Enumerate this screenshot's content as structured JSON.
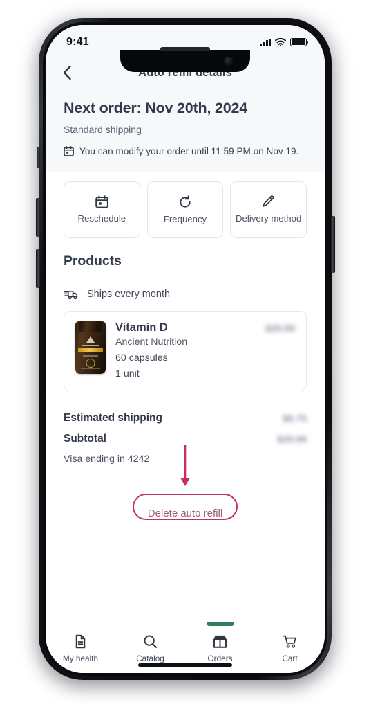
{
  "status_bar": {
    "time": "9:41",
    "signal_icon": "cellular-bars-icon",
    "wifi_icon": "wifi-icon",
    "battery_icon": "battery-full-icon"
  },
  "header": {
    "back_icon": "chevron-left-icon",
    "title": "Auto refill details"
  },
  "hero": {
    "next_order": "Next order: Nov 20th, 2024",
    "shipping_method": "Standard shipping",
    "modify_icon": "calendar-icon",
    "modify_notice": "You can modify your order until 11:59 PM on Nov 19."
  },
  "actions": [
    {
      "label": "Reschedule",
      "icon": "calendar-icon"
    },
    {
      "label": "Frequency",
      "icon": "refresh-cycle-icon"
    },
    {
      "label": "Delivery method",
      "icon": "pencil-icon"
    }
  ],
  "products": {
    "section_title": "Products",
    "ships_icon": "delivery-truck-icon",
    "ships_text": "Ships every month",
    "items": [
      {
        "name": "Vitamin D",
        "brand": "Ancient Nutrition",
        "size": "60 capsules",
        "quantity": "1 unit",
        "price": "$29.99",
        "image": "supplement-bottle-image"
      }
    ]
  },
  "totals": {
    "rows": [
      {
        "label": "Estimated shipping",
        "value": "$6.75"
      },
      {
        "label": "Subtotal",
        "value": "$29.99"
      }
    ],
    "payment_method": "Visa ending in 4242"
  },
  "delete": {
    "label": "Delete auto refill",
    "annotation_icon": "arrow-down-annotation",
    "annotation_color": "#c4305c",
    "highlight_color": "#c4305c"
  },
  "tabbar": {
    "active_index": 2,
    "active_color": "#2e7d5b",
    "items": [
      {
        "label": "My health",
        "icon": "document-icon"
      },
      {
        "label": "Catalog",
        "icon": "search-icon"
      },
      {
        "label": "Orders",
        "icon": "open-box-icon"
      },
      {
        "label": "Cart",
        "icon": "shopping-cart-icon"
      }
    ]
  }
}
